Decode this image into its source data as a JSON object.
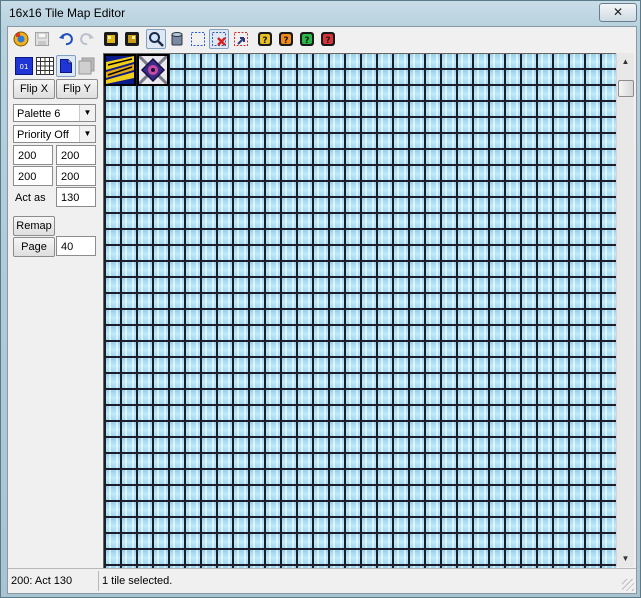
{
  "window": {
    "title": "16x16 Tile Map Editor",
    "close_glyph": "✕"
  },
  "toolbar": {
    "buttons": [
      {
        "name": "info-icon"
      },
      {
        "name": "save-icon"
      },
      {
        "name": "undo-icon"
      },
      {
        "name": "redo-icon"
      },
      {
        "name": "palette-a-icon"
      },
      {
        "name": "palette-b-icon"
      },
      {
        "name": "zoom-icon"
      },
      {
        "name": "bucket-icon"
      },
      {
        "name": "select-icon"
      },
      {
        "name": "delete-icon"
      },
      {
        "name": "paste-icon"
      },
      {
        "name": "help-yellow-icon"
      },
      {
        "name": "help-orange-icon"
      },
      {
        "name": "help-green-icon"
      },
      {
        "name": "help-red-icon"
      }
    ]
  },
  "panel": {
    "mode_badge": "01",
    "flip_x": "Flip X",
    "flip_y": "Flip Y",
    "palette": "Palette 6",
    "priority": "Priority Off",
    "val_1a": "200",
    "val_1b": "200",
    "val_2a": "200",
    "val_2b": "200",
    "act_as_label": "Act as",
    "act_as_value": "130",
    "remap": "Remap",
    "page_label": "Page",
    "page_value": "40"
  },
  "status": {
    "left": "200: Act 130",
    "right": "1 tile selected."
  },
  "colors": {
    "grid_blue": "#aee3f5",
    "grid_line": "#1d1d2c",
    "accent": "#1f35d6"
  }
}
